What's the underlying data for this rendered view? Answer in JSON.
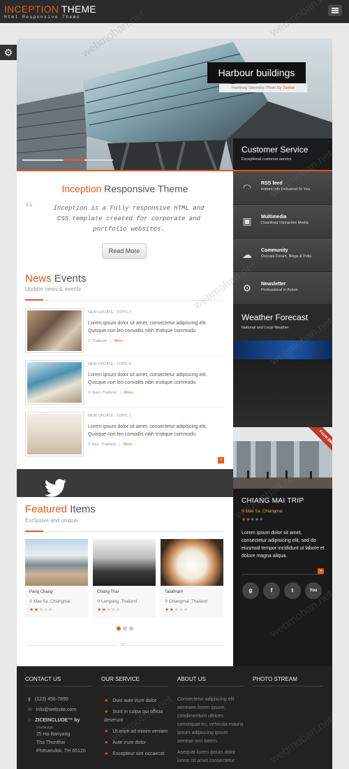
{
  "header": {
    "logo_primary": "INCEPTION",
    "logo_secondary": "THEME",
    "tagline": "Html Responsive Theme"
  },
  "slider": {
    "title": "Harbour buildings",
    "caption_text": "Hamburg Germany. Photo ",
    "caption_author": "By Zamba",
    "progress_fraction": 0.45
  },
  "customer_service": {
    "title": "Customer Service",
    "subtitle": "Exceptional customer service"
  },
  "intro": {
    "title_accent": "Inception",
    "title_rest": "Responsive Theme",
    "quote_mark": "“",
    "text": "Inception is a Fully responsive HTML and CSS template created for corporate and portfolio websites.",
    "button": "Read More"
  },
  "news": {
    "title_accent": "News",
    "title_rest": "Events",
    "subtitle": "Update news & events",
    "items": [
      {
        "category": "NEW UPDATE , TOPIC 2",
        "text": "Lorem ipsum dolor sit amet, consectetur adipiscing elit. Quisque non leo convallis nibh tristique commodo.",
        "location": "Thailand",
        "more": "More"
      },
      {
        "category": "NEW UPDATE , TOPIC 6",
        "text": "Lorem ipsum dolor sit amet, consectetur adipiscing elit. Quisque non leo convallis nibh tristique commodo.",
        "location": "Siam,Thailand",
        "more": "More"
      },
      {
        "category": "NEW UPDATE , TOPIC 1",
        "text": "Lorem ipsum dolor sit amet, consectetur adipiscing elit. Quisque non leo convallis nibh tristique commodo.",
        "location": "Nan ,Thailand",
        "more": "More"
      }
    ],
    "arrow": "»"
  },
  "featured": {
    "title_accent": "Featured",
    "title_rest": "Items",
    "subtitle": "Exclusive and unique",
    "items": [
      {
        "name": "Pang Chang",
        "location": "Mae Sa ,Chiangmai",
        "rating": 2
      },
      {
        "name": "Chang Thai",
        "location": "Lampang ,Thailand",
        "rating": 2
      },
      {
        "name": "Taladnam",
        "location": "Chiangmai ,Thailand",
        "rating": 2
      }
    ],
    "divider_glyph": "≈",
    "active_page": 1,
    "page_count": 3
  },
  "side_menu": [
    {
      "icon": "rss-icon",
      "glyph": "◠",
      "title": "RSS feed",
      "subtitle": "Instant Info Delivered To You"
    },
    {
      "icon": "image-icon",
      "glyph": "▣",
      "title": "Multimedia",
      "subtitle": "Download Interactive Media"
    },
    {
      "icon": "cloud-icon",
      "glyph": "☁",
      "title": "Community",
      "subtitle": "Discuss Forum, Blogs & Polls"
    },
    {
      "icon": "gear-icon",
      "glyph": "⚙",
      "title": "Newsletter",
      "subtitle": "Professional in Action"
    }
  ],
  "weather": {
    "title": "Weather Forecast",
    "subtitle": "National and Local Weather"
  },
  "trip": {
    "ribbon": "From $99",
    "title": "CHIANG MAI TRIP",
    "location": "Mae Sa ,Chiangmai",
    "rating": 2,
    "text": "Lorem ipsum dolor sit amet, consectetur adipisicing elit, sed do eiusmod tempor incididunt ut labore et dolore magna aliqua.",
    "arrow": "»",
    "social": [
      {
        "icon": "google-icon",
        "label": "g"
      },
      {
        "icon": "facebook-icon",
        "label": "f"
      },
      {
        "icon": "twitter-icon",
        "label": "t"
      },
      {
        "icon": "youtube-icon",
        "label": "You"
      }
    ]
  },
  "footer": {
    "contact": {
      "heading": "CONTACT US",
      "phone": "(123) 456-7890",
      "email": "info@website.com",
      "brand": "ZICEINCLUDE™ by",
      "brand_sub": "zicedesign",
      "address_1": "25 Ha Banyang",
      "address_2": "Tha Thonthai",
      "address_3": "Phitsanulok, TH 65120"
    },
    "service": {
      "heading": "OUR SERVICE",
      "items": [
        "Duis aute irure dolor",
        "Sunt in culpa qui officia deserunt",
        "Ut enim ad minim veniam",
        "Aute irure dolor",
        "Excepteur sint occaecat"
      ]
    },
    "about": {
      "heading": "ABOUT US",
      "text_1": "Consectetur adipiscing elit aeneane lorem ipsum, condimentum ultrices consequat eu, vehicula mauris ipsum adipiscing ipsum aenean orci lorem.",
      "text_2": "Asequat lorem ipsum dolor lorem sit amet consectetur"
    },
    "photo": {
      "heading": "PHOTO STREAM"
    }
  },
  "watermark": "webmoban.net",
  "colors": {
    "accent": "#e05a1e",
    "dark": "#2b2b2b"
  }
}
